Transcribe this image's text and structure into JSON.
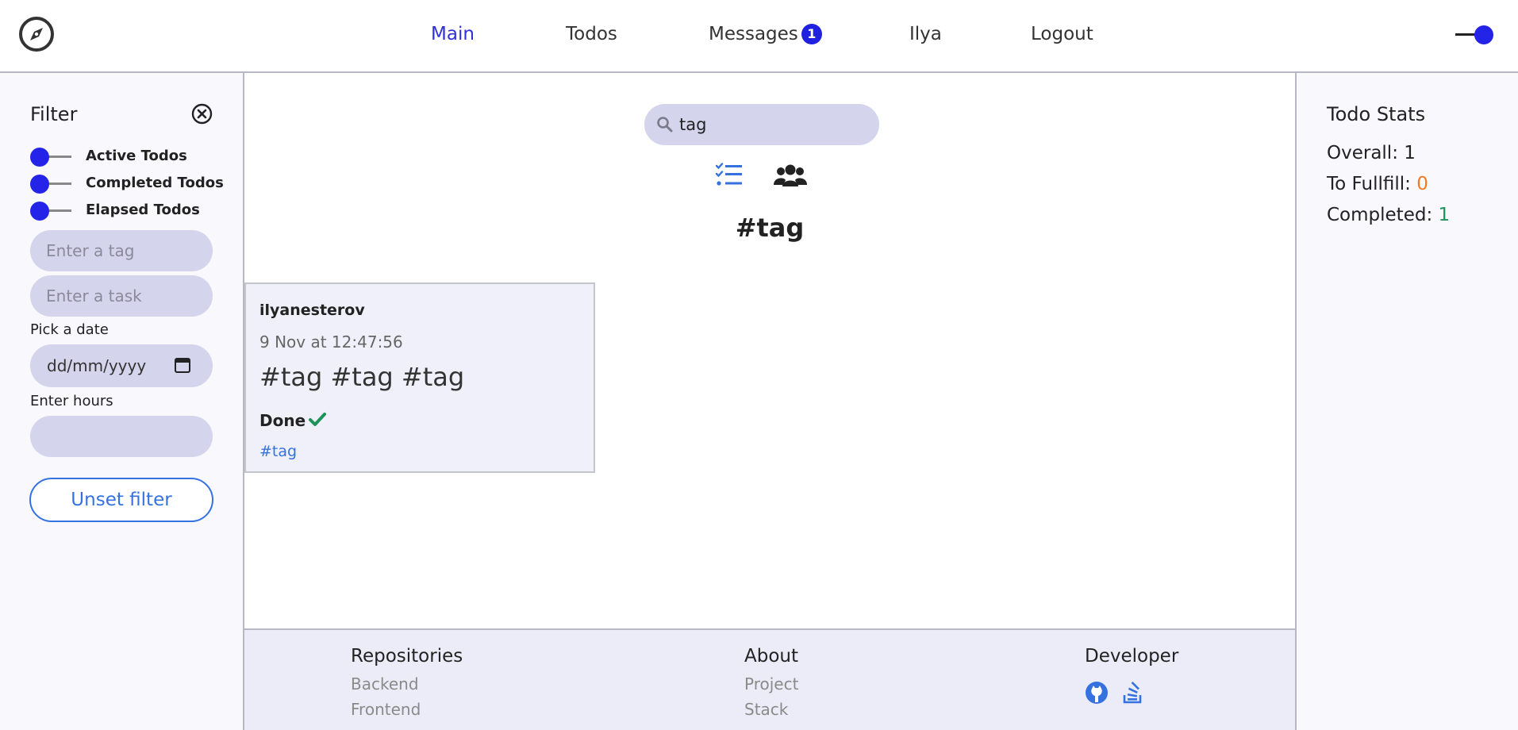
{
  "header": {
    "nav": [
      {
        "label": "Main",
        "active": true
      },
      {
        "label": "Todos"
      },
      {
        "label": "Messages",
        "badge": "1"
      },
      {
        "label": "Ilya"
      },
      {
        "label": "Logout"
      }
    ],
    "logo_icon": "compass-icon",
    "theme_toggle_icon": "toggle-switch-icon"
  },
  "sidebar": {
    "title": "Filter",
    "close_icon": "close-circle-icon",
    "toggles": [
      {
        "label": "Active Todos"
      },
      {
        "label": "Completed Todos"
      },
      {
        "label": "Elapsed Todos"
      }
    ],
    "tag_placeholder": "Enter a tag",
    "task_placeholder": "Enter a task",
    "date_label": "Pick a date",
    "date_placeholder": "dd/mm/yyyy",
    "hours_label": "Enter hours",
    "unset_label": "Unset filter"
  },
  "main": {
    "search": {
      "value": "tag",
      "icon": "search-icon"
    },
    "view_icons": [
      "list-check-icon",
      "users-icon"
    ],
    "heading": "#tag",
    "todo": {
      "user": "ilyanesterov",
      "date": "9 Nov at 12:47:56",
      "text": "#tag #tag #tag",
      "status": "Done",
      "status_icon": "check-icon",
      "tag": "#tag"
    }
  },
  "footer": {
    "repositories": {
      "title": "Repositories",
      "links": [
        "Backend",
        "Frontend"
      ]
    },
    "about": {
      "title": "About",
      "links": [
        "Project",
        "Stack"
      ]
    },
    "developer": {
      "title": "Developer",
      "icons": [
        "github-icon",
        "stackoverflow-icon"
      ]
    }
  },
  "stats": {
    "title": "Todo Stats",
    "overall_label": "Overall: ",
    "overall": "1",
    "fulfill_label": "To Fullfill: ",
    "fulfill": "0",
    "completed_label": "Completed: ",
    "completed": "1"
  },
  "colors": {
    "accent": "#2424e8",
    "link": "#3572e0",
    "input_bg": "#d4d4ec",
    "orange": "#f07b22",
    "green": "#20935a"
  }
}
